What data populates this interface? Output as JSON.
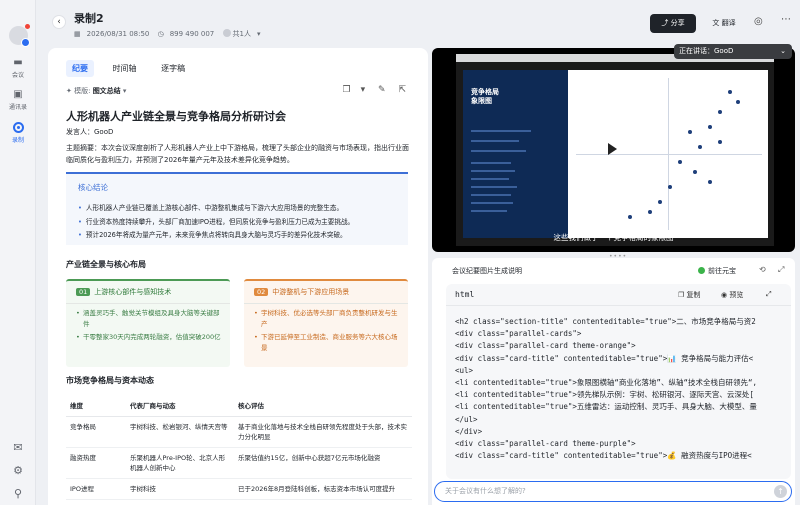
{
  "rail": {
    "items": [
      {
        "label": "会议"
      },
      {
        "label": "通讯录"
      },
      {
        "label": "录制"
      }
    ]
  },
  "header": {
    "title": "录制2",
    "datetime": "2026/08/31 08:50",
    "meeting_id": "899 490 007",
    "attendees": "共1人",
    "share_label": "分享",
    "translate_label": "翻译"
  },
  "tabs": [
    {
      "label": "纪要"
    },
    {
      "label": "时间轴"
    },
    {
      "label": "逐字稿"
    }
  ],
  "template": {
    "prefix": "模版:",
    "name": "图文总结"
  },
  "doc": {
    "title": "人形机器人产业链全景与竞争格局分析研讨会",
    "speaker": "发言人：GooD",
    "summary": "主题摘要：本次会议深度剖析了人形机器人产业上中下游格局，梳理了头部企业的融资与市场表现，指出行业面临同质化与盈利压力，并预测了2026年量产元年及技术差异化竞争趋势。",
    "core_title": "核心结论",
    "core_items": [
      "人形机器人产业链已覆盖上游核心部件、中游整机集成与下游六大应用场景的完整生态。",
      "行业资本热度持续攀升，头部厂商加速IPO进程，但同质化竞争与盈利压力已成为主要挑战。",
      "预计2026年将成为量产元年，未来竞争焦点将转向具身大脑与灵巧手的差异化技术突破。"
    ],
    "section1": "产业链全景与核心布局",
    "card_green": {
      "num": "01",
      "title": "上游核心部件与感知技术",
      "items": [
        "涵盖灵巧手、触觉关节模组及具身大脑等关键部件",
        "干零整家30天内完成两轮融资，估值突破200亿"
      ]
    },
    "card_orange": {
      "num": "02",
      "title": "中游整机与下游应用场景",
      "items": [
        "宇树科技、优必选等头部厂商负责整机研发与生产",
        "下游已延伸至工业制造、商业服务等六大核心场景"
      ]
    },
    "section2": "市场竞争格局与资本动态",
    "table": {
      "headers": [
        "维度",
        "代表厂商与动态",
        "核心评估"
      ],
      "rows": [
        [
          "竞争格局",
          "宇树科技、松岩银河、纵情天宫等",
          "基于商业化落地与技术全栈自研领先程度处于头部，技术实力分化明显"
        ],
        [
          "融资热度",
          "乐聚机器人Pre-IPO轮、北京人形机器人创新中心",
          "乐聚估值约15亿，创新中心获超7亿元市场化融资"
        ],
        [
          "IPO进程",
          "宇树科技",
          "已于2026年8月登陆科创板，标志资本市场认可度提升"
        ]
      ]
    }
  },
  "video": {
    "speaking": "正在讲话：GooD",
    "subtitle": "这些我们做了一个竞争格局的象限图",
    "slide_title": "竞争格局\n象限图"
  },
  "panel": {
    "title": "会议纪要图片生成说明",
    "yuanbao": "前往元宝",
    "code_lang": "html",
    "copy_label": "复制",
    "preview_label": "预览"
  },
  "code_lines": [
    "<h2 class=\"section-title\" contenteditable=\"true\">二、市场竞争格局与资2",
    "<div class=\"parallel-cards\">",
    "<div class=\"parallel-card theme-orange\">",
    "<div class=\"card-title\" contenteditable=\"true\">📊 竞争格局与能力评估<",
    "<ul>",
    "<li contenteditable=\"true\">象限图横轴“商业化落地”、纵轴“技术全栈自研领先“,",
    "<li contenteditable=\"true\">领先梯队示例：宇树、松研银河、逐际天宫、云深处[",
    "<li contenteditable=\"true\">五维雷达：运动控制、灵巧手、具身大脑、大模型、量",
    "</ul>",
    "</div>",
    "<div class=\"parallel-card theme-purple\">",
    "<div class=\"card-title\" contenteditable=\"true\">💰 融资热度与IPO进程<"
  ],
  "ask_placeholder": "关于会议有什么想了解的?"
}
